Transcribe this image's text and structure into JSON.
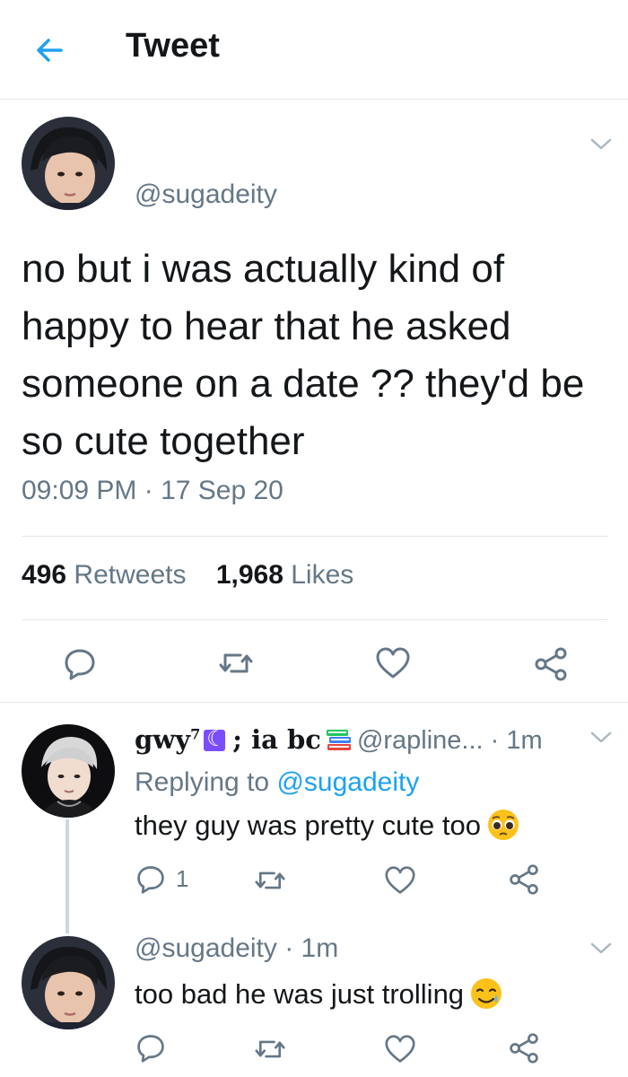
{
  "header": {
    "title": "Tweet",
    "back_icon": "arrow-left-icon",
    "accent": "#1da1f2"
  },
  "tweet": {
    "handle": "@sugadeity",
    "text": "no but i was actually kind of happy to hear that he asked someone on a date ?? they'd be so cute together",
    "timestamp": "09:09 PM · 17 Sep 20",
    "retweets_count": "496",
    "retweets_label": "Retweets",
    "likes_count": "1,968",
    "likes_label": "Likes",
    "actions": [
      "reply-icon",
      "retweet-icon",
      "like-icon",
      "share-icon"
    ]
  },
  "reply1": {
    "display_name_a": "gwy",
    "sup": "7",
    "moon": "☾",
    "display_name_b": "; ia bc",
    "handle": "@rapline...",
    "time": "· 1m",
    "replying_prefix": "Replying to",
    "replying_handle": "@sugadeity",
    "text": "they guy was pretty cute too",
    "reply_count": "1"
  },
  "reply2": {
    "handle": "@sugadeity",
    "time": "· 1m",
    "text": "too bad he was just trolling"
  }
}
